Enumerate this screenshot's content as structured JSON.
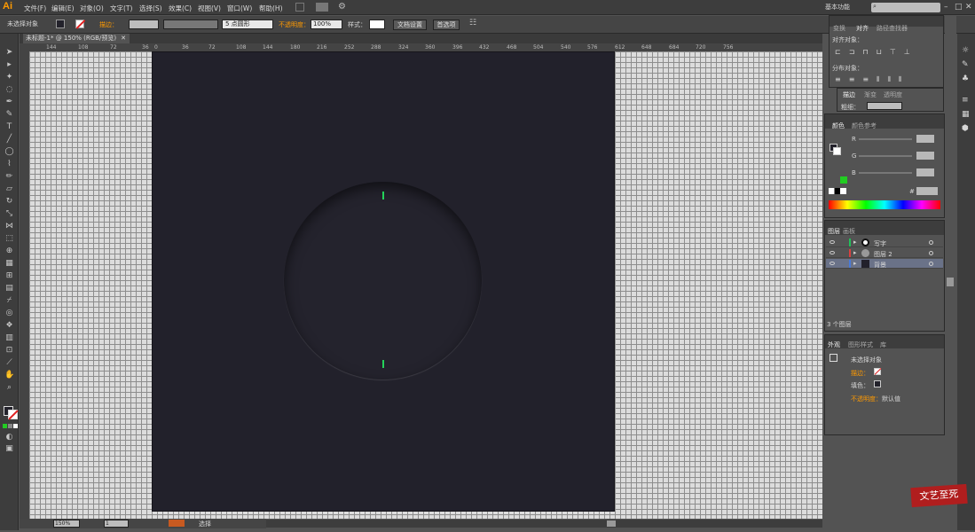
{
  "app": {
    "logo": "Ai",
    "workspace": "基本功能",
    "search_placeholder": ""
  },
  "menu": [
    "文件(F)",
    "编辑(E)",
    "对象(O)",
    "文字(T)",
    "选择(S)",
    "效果(C)",
    "视图(V)",
    "窗口(W)",
    "帮助(H)"
  ],
  "control": {
    "no_selection": "未选择对象",
    "stroke_label": "描边：",
    "brush_size": "5 点圆形",
    "opacity_label": "不透明度：",
    "opacity_value": "100%",
    "style_label": "样式：",
    "doc_setup": "文档设置",
    "prefs": "首选项"
  },
  "document": {
    "tab_title": "未标题-1* @ 150% (RGB/预览)"
  },
  "ruler": {
    "ticks": [
      "144",
      "108",
      "72",
      "36",
      "0",
      "36",
      "72",
      "108",
      "144",
      "180",
      "216",
      "252",
      "288",
      "324",
      "360",
      "396",
      "432",
      "468",
      "504",
      "540",
      "576",
      "612",
      "648",
      "684",
      "720",
      "756"
    ]
  },
  "status": {
    "zoom": "150%",
    "page": "1",
    "mode": "选择"
  },
  "panels": {
    "align": {
      "tabs": [
        "变换",
        "对齐",
        "路径查找器"
      ],
      "align_objects": "对齐对象：",
      "distribute_objects": "分布对象："
    },
    "stroke": {
      "tabs": [
        "描边",
        "渐变",
        "透明度"
      ],
      "weight_label": "粗细："
    },
    "color": {
      "tabs": [
        "颜色",
        "颜色参考"
      ],
      "channels": [
        "R",
        "G",
        "B"
      ],
      "hash": "#"
    },
    "layers": {
      "tabs": [
        "图层",
        "画板"
      ],
      "rows": [
        {
          "name": "写字",
          "color": "#22c05a"
        },
        {
          "name": "图层 2",
          "color": "#d94040"
        },
        {
          "name": "背景",
          "color": "#4a7bd9"
        }
      ],
      "count": "3 个图层"
    },
    "appearance": {
      "tabs": [
        "外观",
        "图形样式",
        "库"
      ],
      "no_selection": "未选择对象",
      "stroke": "描边：",
      "fill": "填色：",
      "opacity": "不透明度：",
      "opacity_value": "默认值"
    }
  },
  "watermark": "文艺至死",
  "colors": {
    "accent": "#ff9a00",
    "artboard": "#22212b",
    "tick": "#24d35a"
  }
}
